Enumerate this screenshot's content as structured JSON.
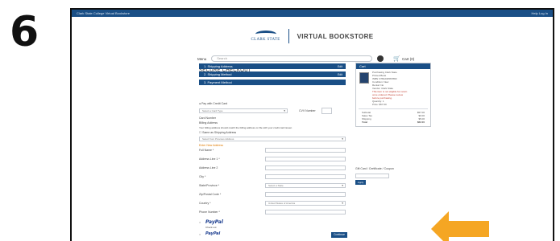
{
  "step_number": "6",
  "topbar": {
    "left": "Clark State College Virtual Bookstore",
    "right": "Help  Log In"
  },
  "header": {
    "logo_text": "CLARK STATE",
    "title": "VIRTUAL BOOKSTORE"
  },
  "search": {
    "menu_label": "Menu",
    "placeholder": "Search",
    "cart_label": "Cart (0)"
  },
  "checkout": {
    "heading": "SECURE CHECKOUT",
    "sections": [
      {
        "label": "1. Shipping Address",
        "tag": "Edit"
      },
      {
        "label": "2. Shipping Method",
        "tag": "Edit"
      },
      {
        "label": "3. Payment Method",
        "tag": ""
      }
    ]
  },
  "payment_form": {
    "credit_card_option": "Pay with Credit Card",
    "card_type_value": "Select a Card Type",
    "card_number_label": "Card Number",
    "cvv_label": "CVV Number",
    "billing_address_label": "Billing Address",
    "billing_note": "Your billing address should match the billing address on file with your credit card issuer.",
    "same_as_shipping": "Same as Shipping Address",
    "previous_address_value": "Select from Previous Address",
    "new_address_label": "Enter New Address",
    "rows": [
      {
        "label": "Full Name *",
        "type": "text",
        "value": ""
      },
      {
        "label": "Address Line 1 *",
        "type": "text",
        "value": ""
      },
      {
        "label": "Address Line 2",
        "type": "text",
        "value": ""
      },
      {
        "label": "City *",
        "type": "text",
        "value": ""
      },
      {
        "label": "State/Province *",
        "type": "select",
        "value": "Select a State"
      },
      {
        "label": "Zip/Postal Code *",
        "type": "text",
        "value": ""
      },
      {
        "label": "Country *",
        "type": "select",
        "value": "United States of America"
      },
      {
        "label": "Phone Number *",
        "type": "text",
        "value": ""
      }
    ],
    "paypal_label": "PayPal",
    "paypal_sub": "Check out",
    "paypal_credit_label": "PayPal",
    "continue_button": "Continue"
  },
  "cart_summary": {
    "heading": "Cart",
    "item_lines": [
      "Purchasing Clark State",
      "Printed Book",
      "ISBN: 9781234567890",
      "Condition:  New",
      "Rental:  No",
      "Vendor:  Clark State",
      "This item is not eligible for return",
      "once ordered. Please review",
      "before purchasing.",
      "Quantity:  1",
      "Price:  $57.00"
    ],
    "totals": [
      {
        "label": "Subtotal",
        "value": "$57.00"
      },
      {
        "label": "Sales Tax",
        "value": "$0.00"
      },
      {
        "label": "Shipping",
        "value": "$5.00"
      },
      {
        "label": "Total",
        "value": "$62.00"
      }
    ],
    "gift_card_label": "Gift Card / Certificate / Coupon",
    "apply_button": "Apply"
  },
  "colors": {
    "brand": "#1a4f86",
    "arrow": "#f5a623",
    "warning": "#c0392b",
    "label_orange": "#e07b00"
  },
  "icons": [
    "cart-icon",
    "search-go-icon",
    "chevron-down-icon",
    "paypal-icon",
    "callout-arrow-icon"
  ]
}
